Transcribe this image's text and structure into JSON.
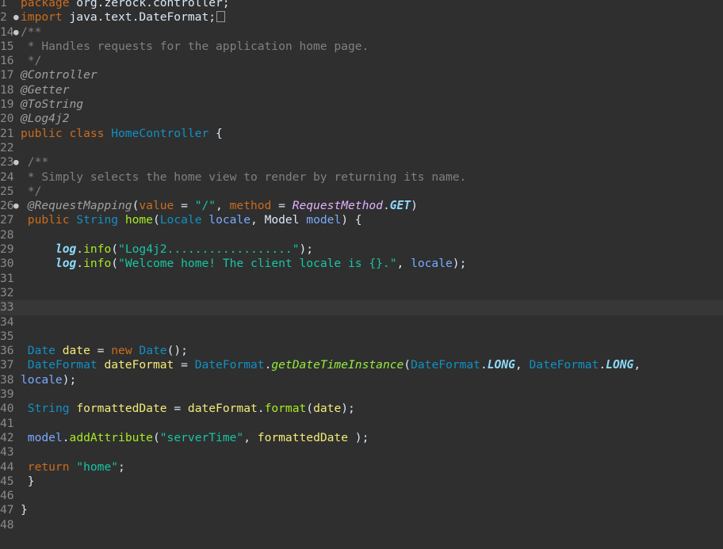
{
  "colors": {
    "background": "#2f2f2f",
    "current_line": "#373737",
    "line_number": "#8a8a8a",
    "keyword": "#cc6c1d",
    "comment": "#808080",
    "annotation": "#a0a0a0",
    "type": "#1290c3",
    "string": "#17c6a3",
    "local_variable": "#f3ec79",
    "method": "#a7ec21",
    "static_field": "#8dd9fc",
    "enum": "#cd7cff"
  },
  "editor": {
    "current_line": "33",
    "lines": [
      {
        "n": "1",
        "fold": "",
        "tokens": [
          [
            "kw",
            "package "
          ],
          [
            "plain",
            "org.zerock.controller;"
          ]
        ]
      },
      {
        "n": "2",
        "fold": "●",
        "tokens": [
          [
            "kw",
            "import "
          ],
          [
            "plain",
            "java.text.DateFormat;"
          ],
          [
            "box",
            "collapsed"
          ]
        ]
      },
      {
        "n": "14",
        "fold": "●",
        "tokens": [
          [
            "comment",
            "/**"
          ]
        ]
      },
      {
        "n": "15",
        "fold": "",
        "tokens": [
          [
            "comment",
            " * Handles requests for the application home page."
          ]
        ]
      },
      {
        "n": "16",
        "fold": "",
        "tokens": [
          [
            "comment",
            " */"
          ]
        ]
      },
      {
        "n": "17",
        "fold": "",
        "tokens": [
          [
            "ann",
            "@Controller"
          ]
        ]
      },
      {
        "n": "18",
        "fold": "",
        "tokens": [
          [
            "ann",
            "@Getter"
          ]
        ]
      },
      {
        "n": "19",
        "fold": "",
        "tokens": [
          [
            "ann",
            "@ToString"
          ]
        ]
      },
      {
        "n": "20",
        "fold": "",
        "tokens": [
          [
            "ann",
            "@Log4j2"
          ]
        ]
      },
      {
        "n": "21",
        "fold": "",
        "tokens": [
          [
            "kw",
            "public "
          ],
          [
            "kw",
            "class "
          ],
          [
            "type",
            "HomeController"
          ],
          [
            "plain",
            " {"
          ]
        ]
      },
      {
        "n": "22",
        "fold": "",
        "tokens": []
      },
      {
        "n": "23",
        "fold": "●",
        "tokens": [
          [
            "comment",
            " /**"
          ]
        ]
      },
      {
        "n": "24",
        "fold": "",
        "tokens": [
          [
            "comment",
            " * Simply selects the home view to render by returning its name."
          ]
        ]
      },
      {
        "n": "25",
        "fold": "",
        "tokens": [
          [
            "comment",
            " */"
          ]
        ]
      },
      {
        "n": "26",
        "fold": "●",
        "tokens": [
          [
            "ann",
            " @RequestMapping"
          ],
          [
            "plain",
            "("
          ],
          [
            "kw",
            "value"
          ],
          [
            "plain",
            " = "
          ],
          [
            "string",
            "\"/\""
          ],
          [
            "plain",
            ", "
          ],
          [
            "kw",
            "method"
          ],
          [
            "plain",
            " = "
          ],
          [
            "enumtype",
            "RequestMethod"
          ],
          [
            "plain",
            "."
          ],
          [
            "static",
            "GET"
          ],
          [
            "plain",
            ")"
          ]
        ]
      },
      {
        "n": "27",
        "fold": "",
        "tokens": [
          [
            "kw",
            " public "
          ],
          [
            "type",
            "String "
          ],
          [
            "method",
            "home"
          ],
          [
            "plain",
            "("
          ],
          [
            "type",
            "Locale "
          ],
          [
            "param",
            "locale"
          ],
          [
            "plain",
            ", "
          ],
          [
            "plain",
            "Model "
          ],
          [
            "param",
            "model"
          ],
          [
            "plain",
            ") {"
          ]
        ]
      },
      {
        "n": "28",
        "fold": "",
        "tokens": []
      },
      {
        "n": "29",
        "fold": "",
        "tokens": [
          [
            "plain",
            "     "
          ],
          [
            "fieldstatic",
            "log"
          ],
          [
            "plain",
            "."
          ],
          [
            "method",
            "info"
          ],
          [
            "plain",
            "("
          ],
          [
            "string",
            "\"Log4j2..................\""
          ],
          [
            "plain",
            ");"
          ]
        ]
      },
      {
        "n": "30",
        "fold": "",
        "tokens": [
          [
            "plain",
            "     "
          ],
          [
            "fieldstatic",
            "log"
          ],
          [
            "plain",
            "."
          ],
          [
            "method",
            "info"
          ],
          [
            "plain",
            "("
          ],
          [
            "string",
            "\"Welcome home! The client locale is {}.\""
          ],
          [
            "plain",
            ", "
          ],
          [
            "param",
            "locale"
          ],
          [
            "plain",
            ");"
          ]
        ]
      },
      {
        "n": "31",
        "fold": "",
        "tokens": []
      },
      {
        "n": "32",
        "fold": "",
        "tokens": []
      },
      {
        "n": "33",
        "fold": "",
        "tokens": []
      },
      {
        "n": "34",
        "fold": "",
        "tokens": []
      },
      {
        "n": "35",
        "fold": "",
        "tokens": []
      },
      {
        "n": "36",
        "fold": "",
        "tokens": [
          [
            "plain",
            " "
          ],
          [
            "type",
            "Date "
          ],
          [
            "var",
            "date"
          ],
          [
            "plain",
            " = "
          ],
          [
            "kw",
            "new "
          ],
          [
            "type",
            "Date"
          ],
          [
            "plain",
            "();"
          ]
        ]
      },
      {
        "n": "37",
        "fold": "",
        "tokens": [
          [
            "plain",
            " "
          ],
          [
            "type",
            "DateFormat "
          ],
          [
            "var",
            "dateFormat"
          ],
          [
            "plain",
            " = "
          ],
          [
            "type",
            "DateFormat"
          ],
          [
            "plain",
            "."
          ],
          [
            "staticmethod",
            "getDateTimeInstance"
          ],
          [
            "plain",
            "("
          ],
          [
            "type",
            "DateFormat"
          ],
          [
            "plain",
            "."
          ],
          [
            "const",
            "LONG"
          ],
          [
            "plain",
            ", "
          ],
          [
            "type",
            "DateFormat"
          ],
          [
            "plain",
            "."
          ],
          [
            "const",
            "LONG"
          ],
          [
            "plain",
            ","
          ]
        ]
      },
      {
        "n": "38",
        "fold": "",
        "tokens": [
          [
            "param",
            "locale"
          ],
          [
            "plain",
            ");"
          ]
        ]
      },
      {
        "n": "39",
        "fold": "",
        "tokens": []
      },
      {
        "n": "40",
        "fold": "",
        "tokens": [
          [
            "plain",
            " "
          ],
          [
            "type",
            "String "
          ],
          [
            "var",
            "formattedDate"
          ],
          [
            "plain",
            " = "
          ],
          [
            "var",
            "dateFormat"
          ],
          [
            "plain",
            "."
          ],
          [
            "method",
            "format"
          ],
          [
            "plain",
            "("
          ],
          [
            "var",
            "date"
          ],
          [
            "plain",
            ");"
          ]
        ]
      },
      {
        "n": "41",
        "fold": "",
        "tokens": []
      },
      {
        "n": "42",
        "fold": "",
        "tokens": [
          [
            "plain",
            " "
          ],
          [
            "param",
            "model"
          ],
          [
            "plain",
            "."
          ],
          [
            "method",
            "addAttribute"
          ],
          [
            "plain",
            "("
          ],
          [
            "string",
            "\"serverTime\""
          ],
          [
            "plain",
            ", "
          ],
          [
            "var",
            "formattedDate"
          ],
          [
            "plain",
            " );"
          ]
        ]
      },
      {
        "n": "43",
        "fold": "",
        "tokens": []
      },
      {
        "n": "44",
        "fold": "",
        "tokens": [
          [
            "kw",
            " return "
          ],
          [
            "string",
            "\"home\""
          ],
          [
            "plain",
            ";"
          ]
        ]
      },
      {
        "n": "45",
        "fold": "",
        "tokens": [
          [
            "plain",
            " }"
          ]
        ]
      },
      {
        "n": "46",
        "fold": "",
        "tokens": []
      },
      {
        "n": "47",
        "fold": "",
        "tokens": [
          [
            "plain",
            "}"
          ]
        ]
      },
      {
        "n": "48",
        "fold": "",
        "tokens": []
      }
    ]
  }
}
